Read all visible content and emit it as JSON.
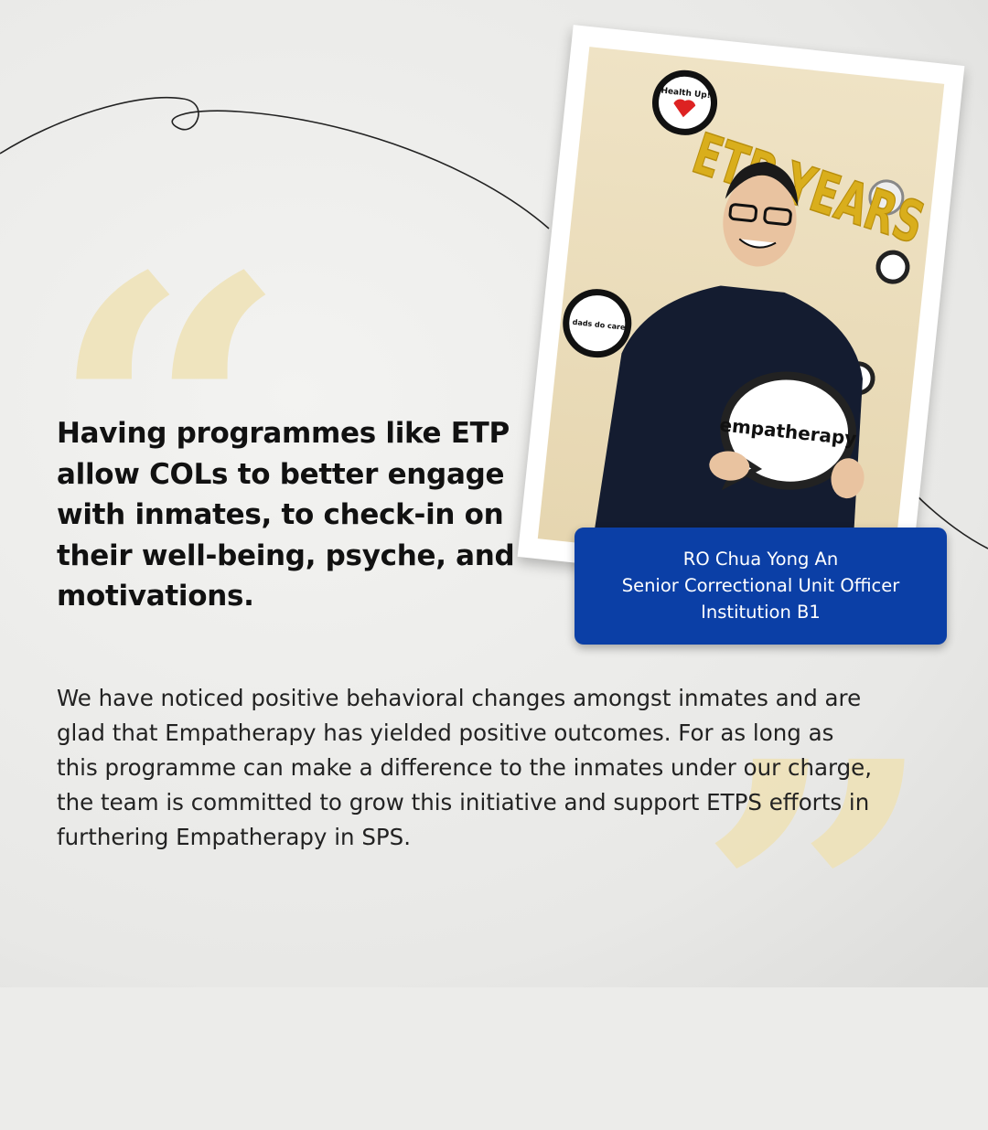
{
  "headline": "Having programmes like ETP allow COLs to better engage with inmates, to check-in on their well-being, psyche, and motivations.",
  "body": "We have noticed positive behavioral changes amongst inmates and are glad that Empatherapy has yielded positive outcomes. For as long as this programme can make a difference to the inmates under our charge, the team is committed to grow this initiative and support ETPS efforts in furthering Empatherapy in SPS.",
  "quote_marks": {
    "open": "“",
    "close": "”",
    "color": "#efe2b6"
  },
  "photo": {
    "sign_text": "empatherapy",
    "badges": [
      "Health Up!",
      "dads do care"
    ],
    "balloons": "ETP YEARS"
  },
  "name_card": {
    "name": "RO Chua Yong An",
    "title": "Senior Correctional Unit Officer",
    "unit": "Institution B1",
    "color": "#0b3fa6"
  }
}
